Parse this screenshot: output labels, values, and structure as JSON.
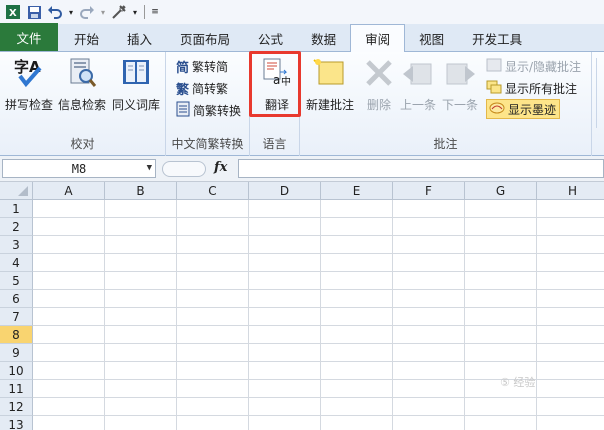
{
  "qat": {
    "icons": [
      "excel-logo-icon",
      "save-icon",
      "undo-icon",
      "redo-icon",
      "tools-icon",
      "customize-icon"
    ]
  },
  "tabs": [
    {
      "label": "文件",
      "kind": "file"
    },
    {
      "label": "开始"
    },
    {
      "label": "插入"
    },
    {
      "label": "页面布局"
    },
    {
      "label": "公式"
    },
    {
      "label": "数据"
    },
    {
      "label": "审阅",
      "active": true
    },
    {
      "label": "视图"
    },
    {
      "label": "开发工具"
    }
  ],
  "ribbon": {
    "proofing": {
      "label": "校对",
      "spell": "拼写检查",
      "research": "信息检索",
      "thesaurus": "同义词库",
      "spell_icon_text": "字A"
    },
    "chinese_conv": {
      "label": "中文简繁转换",
      "to_simplified": "繁转简",
      "to_traditional": "简转繁",
      "convert": "简繁转换",
      "glyph_simplified": "简",
      "glyph_traditional": "繁"
    },
    "language": {
      "label": "语言",
      "translate": "翻译"
    },
    "comments": {
      "label": "批注",
      "new": "新建批注",
      "delete": "删除",
      "previous": "上一条",
      "next": "下一条",
      "show_hide": "显示/隐藏批注",
      "show_all": "显示所有批注",
      "show_ink": "显示墨迹"
    }
  },
  "formula_bar": {
    "name_box": "M8",
    "fx": "fx",
    "value": ""
  },
  "grid": {
    "columns": [
      "A",
      "B",
      "C",
      "D",
      "E",
      "F",
      "G",
      "H"
    ],
    "rows": [
      "1",
      "2",
      "3",
      "4",
      "5",
      "6",
      "7",
      "8",
      "9",
      "10",
      "11",
      "12",
      "13"
    ],
    "selected_row": "8"
  },
  "watermark": "⑤ 经验"
}
